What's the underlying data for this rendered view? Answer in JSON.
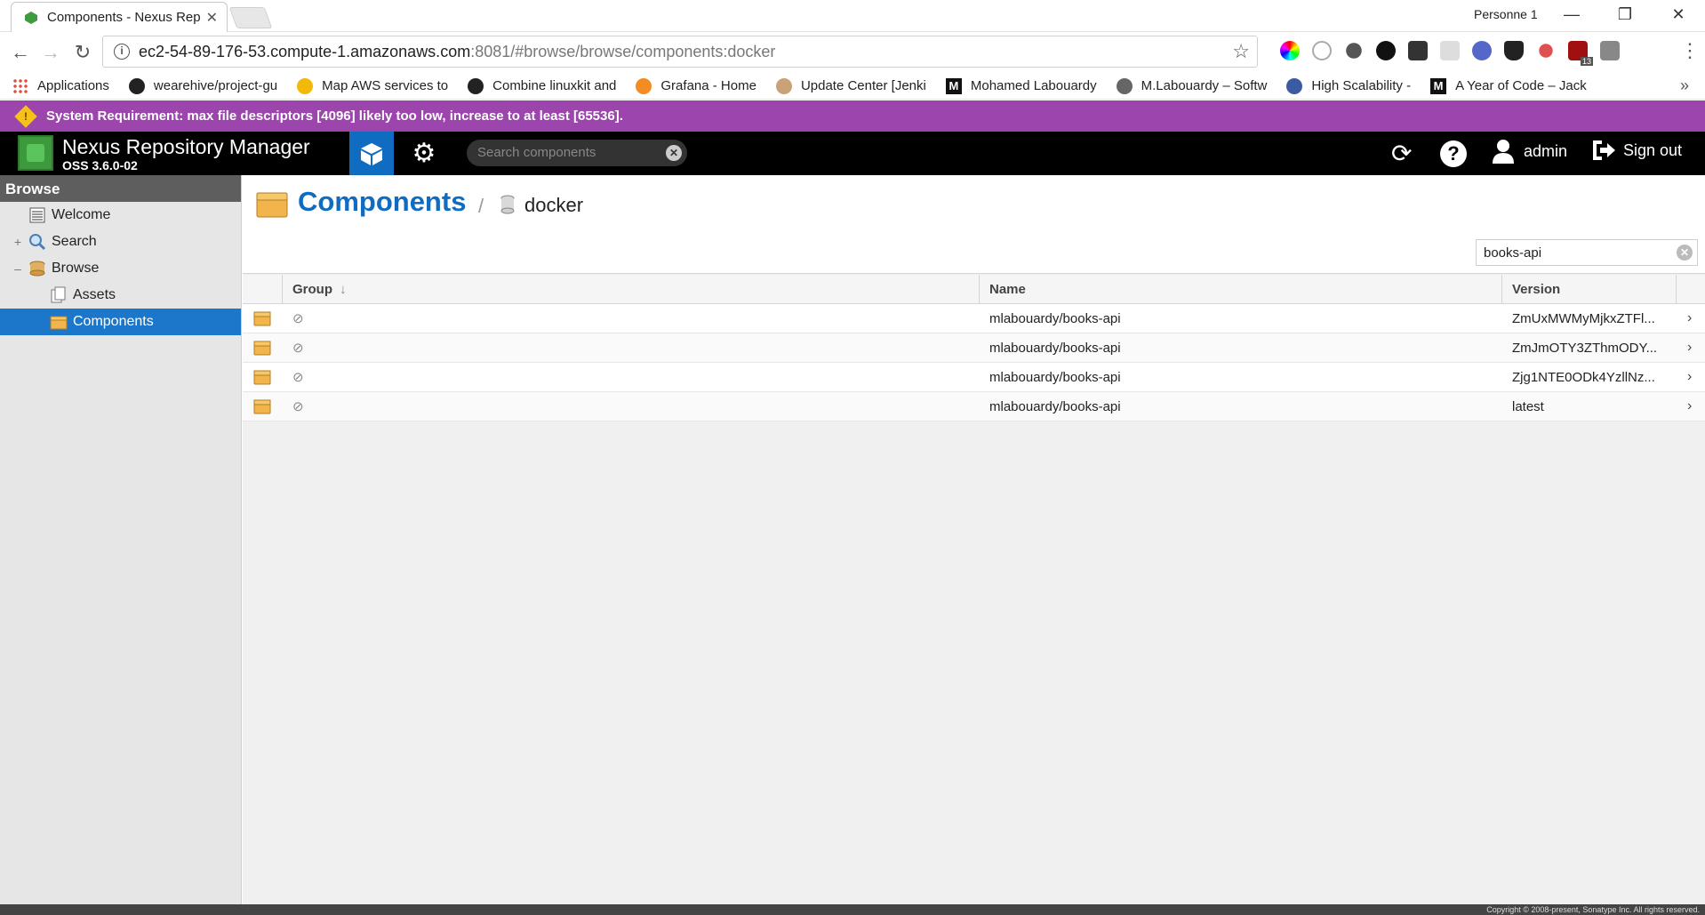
{
  "browser": {
    "tab_title": "Components - Nexus Rep",
    "profile": "Personne 1",
    "url_host": "ec2-54-89-176-53.compute-1.amazonaws.com",
    "url_path": ":8081/#browse/browse/components:docker",
    "bookmarks": [
      {
        "label": "Applications",
        "icon": "apps-grid-icon"
      },
      {
        "label": "wearehive/project-gu",
        "icon": "github-icon"
      },
      {
        "label": "Map AWS services to",
        "icon": "chrome-icon"
      },
      {
        "label": "Combine linuxkit and",
        "icon": "github-icon"
      },
      {
        "label": "Grafana - Home",
        "icon": "grafana-icon"
      },
      {
        "label": "Update Center [Jenki",
        "icon": "jenkins-icon"
      },
      {
        "label": "Mohamed Labouardy",
        "icon": "medium-icon"
      },
      {
        "label": "M.Labouardy – Softw",
        "icon": "site-icon"
      },
      {
        "label": "High Scalability -",
        "icon": "hs-icon"
      },
      {
        "label": "A Year of Code – Jack",
        "icon": "medium-icon"
      }
    ],
    "bookmarks_more": "»",
    "badge_count": "13"
  },
  "warning": {
    "text": "System Requirement: max file descriptors [4096] likely too low, increase to at least [65536]."
  },
  "header": {
    "title": "Nexus Repository Manager",
    "version": "OSS 3.6.0-02",
    "search_placeholder": "Search components",
    "user": "admin",
    "signout": "Sign out"
  },
  "sidebar": {
    "title": "Browse",
    "items": [
      {
        "label": "Welcome",
        "expander": ""
      },
      {
        "label": "Search",
        "expander": "+"
      },
      {
        "label": "Browse",
        "expander": "–"
      },
      {
        "label": "Assets",
        "expander": ""
      },
      {
        "label": "Components",
        "expander": ""
      }
    ]
  },
  "content": {
    "title": "Components",
    "separator": "/",
    "repository": "docker",
    "filter_value": "books-api",
    "columns": {
      "group": "Group",
      "name": "Name",
      "version": "Version"
    },
    "rows": [
      {
        "group": "⊘",
        "name": "mlabouardy/books-api",
        "version": "ZmUxMWMyMjkxZTFl...",
        "arrow": "›"
      },
      {
        "group": "⊘",
        "name": "mlabouardy/books-api",
        "version": "ZmJmOTY3ZThmODY...",
        "arrow": "›"
      },
      {
        "group": "⊘",
        "name": "mlabouardy/books-api",
        "version": "Zjg1NTE0ODk4YzllNz...",
        "arrow": "›"
      },
      {
        "group": "⊘",
        "name": "mlabouardy/books-api",
        "version": "latest",
        "arrow": "›"
      }
    ]
  },
  "footer": {
    "text": "Copyright © 2008-present, Sonatype Inc. All rights reserved."
  },
  "colors": {
    "accent": "#0f6cc0",
    "warning_bg": "#9b45ad",
    "selected": "#1c76c9",
    "header_bg": "#000000"
  }
}
